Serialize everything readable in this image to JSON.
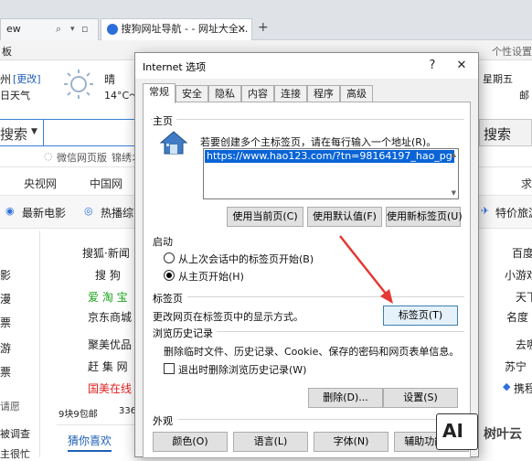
{
  "browser": {
    "tabs": [
      {
        "label": "ew"
      },
      {
        "label": "搜狗网址导航 - - 网址大全..."
      }
    ],
    "new_tab": "+",
    "left_partial": "板",
    "right_label": "个性设置",
    "weather": {
      "city": "州",
      "change": "[更改]",
      "forecast_link": "日天气",
      "condition": "晴",
      "temp": "14°C～2",
      "date": "星期五",
      "mail": "邮"
    },
    "search": {
      "left_label": "搜索",
      "right_label": "搜索",
      "suggest1": "微信网页版",
      "suggest2": "锦绣オ"
    },
    "nav": [
      "央视网",
      "中国网",
      "求"
    ],
    "sub": [
      {
        "label": "最新电影"
      },
      {
        "label": "热播综艺"
      },
      {
        "label": "特价旅游"
      }
    ],
    "links_left": [
      "影",
      "漫",
      "票",
      "游",
      "票",
      "请愿",
      "被调查",
      "主很忙"
    ],
    "links_mid": [
      "搜狐·新闻",
      "搜 狗",
      "爱 淘 宝",
      "京东商城",
      "聚美优品",
      "赶 集 网",
      "国美在线"
    ],
    "links_mid_partial": [
      "9块9包邮",
      "3366"
    ],
    "links_right": [
      "百度",
      "小游戏",
      "天下",
      "名度",
      "去哪",
      "苏宁"
    ],
    "bottom_tab": "猜你喜欢",
    "bottom_right": "携程"
  },
  "dialog": {
    "title": "Internet 选项",
    "help": "?",
    "close": "✕",
    "tabs": [
      "常规",
      "安全",
      "隐私",
      "内容",
      "连接",
      "程序",
      "高级"
    ],
    "homepage": {
      "label": "主页",
      "desc": "若要创建多个主标签页，请在每行输入一个地址(R)。",
      "url": "https://www.hao123.com/?tn=98164197_hao_pg",
      "btn_current": "使用当前页(C)",
      "btn_default": "使用默认值(F)",
      "btn_newtab": "使用新标签页(U)"
    },
    "startup": {
      "label": "启动",
      "opt1": "从上次会话中的标签页开始(B)",
      "opt2": "从主页开始(H)",
      "selected": 2
    },
    "tabs_section": {
      "label": "标签页",
      "desc": "更改网页在标签页中的显示方式。",
      "btn": "标签页(T)"
    },
    "history": {
      "label": "浏览历史记录",
      "desc": "删除临时文件、历史记录、Cookie、保存的密码和网页表单信息。",
      "checkbox": "退出时删除浏览历史记录(W)",
      "checked": false,
      "btn_delete": "删除(D)...",
      "btn_settings": "设置(S)"
    },
    "appearance": {
      "label": "外观",
      "btn_colors": "颜色(O)",
      "btn_language": "语言(L)",
      "btn_fonts": "字体(N)",
      "btn_access": "辅助功能(E)"
    }
  },
  "watermark": {
    "logo": "AI",
    "text": "树叶云"
  },
  "colors": {
    "accent": "#0a64d6",
    "arrow": "#e53935",
    "link_green": "#1aa11a",
    "link_red": "#e02020"
  }
}
